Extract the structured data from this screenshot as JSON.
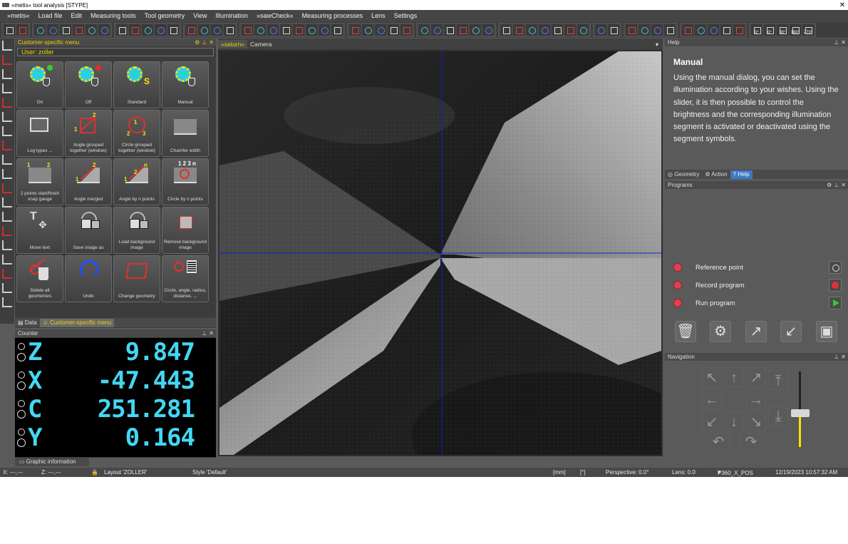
{
  "window": {
    "title": "»metis« tool analysis [STYPE]"
  },
  "menu": [
    "»metis«",
    "Load file",
    "Edit",
    "Measuring tools",
    "Tool geometry",
    "View",
    "Illumination",
    "»sawCheck«",
    "Measuring processes",
    "Lens",
    "Settings"
  ],
  "customer_menu": {
    "title": "Customer-specific menu",
    "user": "User: zoller",
    "tiles": [
      {
        "label": "On",
        "icon": "illumination-on-icon"
      },
      {
        "label": "Off",
        "icon": "illumination-off-icon"
      },
      {
        "label": "Standard",
        "icon": "illumination-standard-icon"
      },
      {
        "label": "Manual",
        "icon": "illumination-manual-icon"
      },
      {
        "label": "Log types ...",
        "icon": "log-types-icon"
      },
      {
        "label": "Angle grouped together (window)",
        "icon": "angle-grouped-icon"
      },
      {
        "label": "Circle grouped together (window)",
        "icon": "circle-grouped-icon"
      },
      {
        "label": "Chamfer width",
        "icon": "chamfer-width-icon"
      },
      {
        "label": "2 points start/finish snap gauge",
        "icon": "two-points-snap-icon"
      },
      {
        "label": "Angle merged",
        "icon": "angle-merged-icon"
      },
      {
        "label": "Angle by n points",
        "icon": "angle-n-points-icon"
      },
      {
        "label": "Circle by n points",
        "icon": "circle-n-points-icon"
      },
      {
        "label": "Move text",
        "icon": "move-text-icon"
      },
      {
        "label": "Save image as",
        "icon": "save-image-icon"
      },
      {
        "label": "Load background image",
        "icon": "load-background-icon"
      },
      {
        "label": "Remove background image",
        "icon": "remove-background-icon"
      },
      {
        "label": "Delete all geometries",
        "icon": "delete-geometries-icon"
      },
      {
        "label": "Undo",
        "icon": "undo-icon"
      },
      {
        "label": "Change geometry",
        "icon": "change-geometry-icon"
      },
      {
        "label": "Circle, angle, radius, distance, ...",
        "icon": "circle-angle-radius-icon"
      }
    ],
    "tabs": [
      "Data",
      "Customer-specific menu"
    ]
  },
  "counter": {
    "title": "Counter",
    "rows": [
      {
        "axis": "Z",
        "value": "9.847"
      },
      {
        "axis": "X",
        "value": "-47.443"
      },
      {
        "axis": "C",
        "value": "251.281"
      },
      {
        "axis": "Y",
        "value": "0.164"
      }
    ],
    "tab": "Graphic information"
  },
  "camera": {
    "tabs": [
      "»saturn«",
      "Camera"
    ],
    "crosshair_color": "#1020c0"
  },
  "help": {
    "header": "Help",
    "title": "Manual",
    "text": "Using the manual dialog, you can set the illumination according to your wishes. Using the slider, it is then possible to control the brightness and the corresponding illumination segment is activated or deactivated using the segment symbols.",
    "tabs": [
      "Geometry",
      "Action",
      "Help"
    ]
  },
  "programs": {
    "header": "Programs",
    "items": [
      "Reference point",
      "Record program",
      "Run program"
    ]
  },
  "navigation": {
    "header": "Navigation",
    "brightness": 0.42
  },
  "status": {
    "x": "X: ---,---",
    "z": "Z: ---,---",
    "layout": "Layout 'ZOLLER'",
    "style": "Style 'Default'",
    "unit_mm": "[mm]",
    "unit_deg": "[°]",
    "perspective": "Perspective: 0.0°",
    "lens": "Lens: 0.0",
    "position": "P360_X_POS",
    "datetime": "12/19/2023 10:57:32 AM"
  },
  "toolbar_angles": [
    "0°",
    "0°",
    "90°",
    "180°",
    "270°"
  ]
}
